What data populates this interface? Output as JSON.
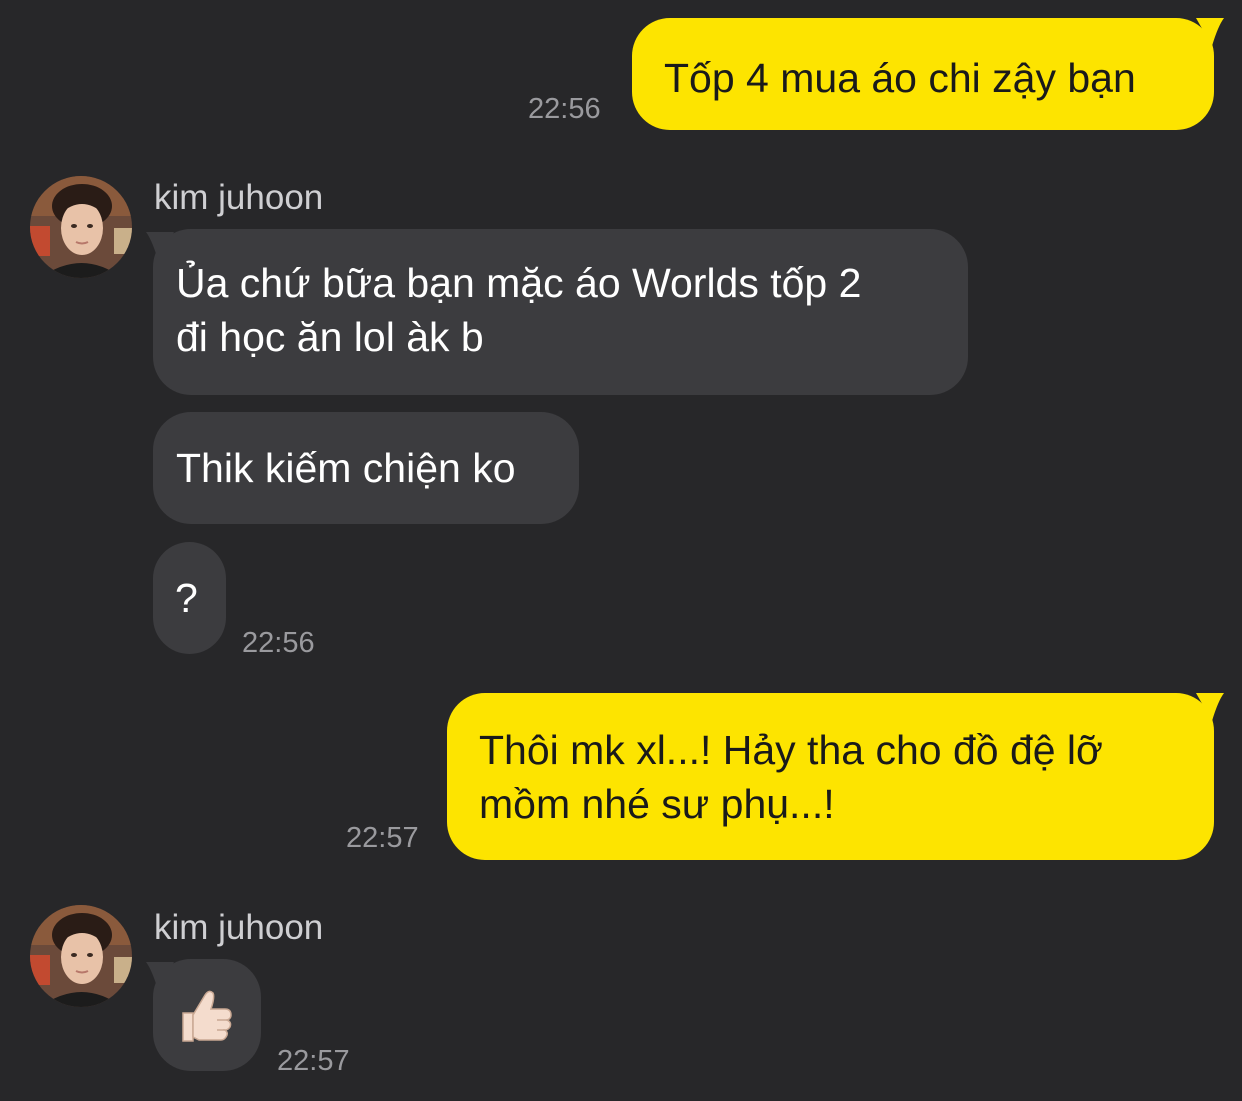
{
  "colors": {
    "background": "#272729",
    "outgoing_bubble": "#fde400",
    "incoming_bubble": "#3c3c3f",
    "timestamp": "#9a9a9e",
    "sender_name": "#cfcfd2"
  },
  "messages": [
    {
      "direction": "outgoing",
      "text": "Tốp 4 mua áo chi zậy bạn",
      "time": "22:56"
    },
    {
      "direction": "incoming",
      "sender": "kim juhoon",
      "lines": [
        "Ủa chứ bữa bạn mặc áo Worlds tốp 2",
        "đi học ăn lol àk b"
      ]
    },
    {
      "direction": "incoming",
      "text": "Thik kiếm chiện ko"
    },
    {
      "direction": "incoming",
      "text": "?",
      "time": "22:56"
    },
    {
      "direction": "outgoing",
      "lines": [
        "Thôi mk xl...! Hảy tha cho đồ đệ lỡ",
        "mồm nhé sư phụ...!"
      ],
      "time": "22:57"
    },
    {
      "direction": "incoming",
      "sender": "kim juhoon",
      "icon": "thumbs-up-emoji",
      "time": "22:57"
    }
  ]
}
